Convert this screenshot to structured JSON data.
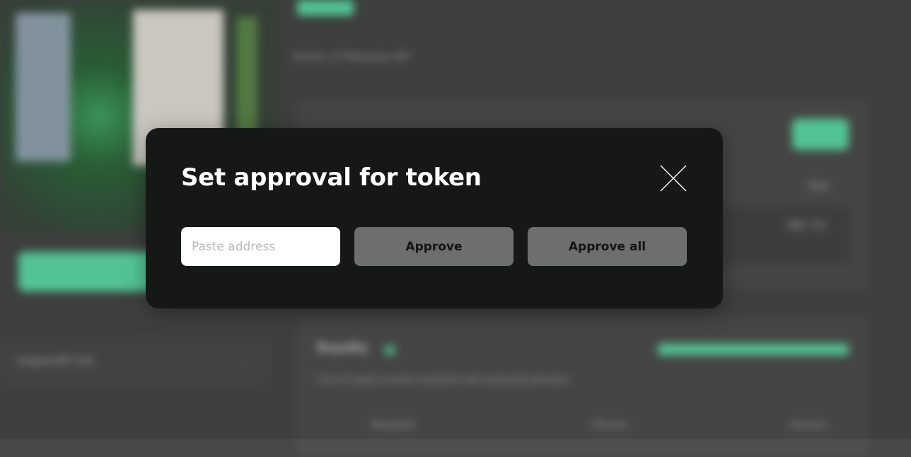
{
  "background": {
    "original_nft_info": "Original NFT Info",
    "subtitle": "DIVVIS | CP Metadata NFT",
    "type_label": "Type",
    "token_standard": "ERC-721",
    "royalty_title": "Royalty",
    "royalty_description": "List of royalty income receivers with personal percents",
    "columns": [
      "Recipient",
      "Percent",
      "Amount"
    ]
  },
  "modal": {
    "title": "Set approval for token",
    "address_placeholder": "Paste address",
    "address_value": "",
    "approve_label": "Approve",
    "approve_all_label": "Approve all",
    "close_icon": "close-icon"
  },
  "colors": {
    "modal_bg": "#161717",
    "button_bg": "#6d6e6d",
    "accent": "#5ee0a8",
    "page_bg": "#474847"
  }
}
